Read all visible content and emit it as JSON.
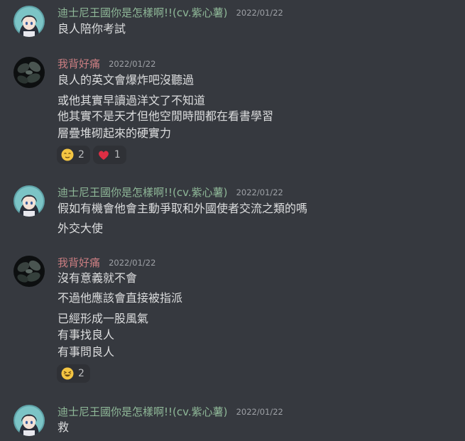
{
  "users": {
    "disney": {
      "name": "迪士尼王國你是怎樣啊!!(cv.紫心薯)",
      "color": "#8fb898"
    },
    "backpain": {
      "name": "我背好痛",
      "color": "#c97d81"
    }
  },
  "messages": [
    {
      "author": "迪士尼王國你是怎樣啊!!(cv.紫心薯)",
      "timestamp": "2022/01/22",
      "avatar": "anime-girl-avatar",
      "lines": [
        "良人陪你考試"
      ]
    },
    {
      "author": "我背好痛",
      "timestamp": "2022/01/22",
      "avatar": "dark-plant-avatar",
      "lines": [
        "良人的英文會爆炸吧沒聽過",
        "或他其實早讀過洋文了不知道",
        "他其實不是天才但他空閒時間都在看書學習",
        "層疊堆砌起來的硬實力"
      ],
      "reactions": [
        {
          "emoji": "relieved-face-emoji",
          "count": "2"
        },
        {
          "emoji": "heart-emoji",
          "count": "1"
        }
      ]
    },
    {
      "author": "迪士尼王國你是怎樣啊!!(cv.紫心薯)",
      "timestamp": "2022/01/22",
      "avatar": "anime-girl-avatar",
      "lines": [
        "假如有機會他會主動爭取和外國使者交流之類的嗎",
        "外交大使"
      ]
    },
    {
      "author": "我背好痛",
      "timestamp": "2022/01/22",
      "avatar": "dark-plant-avatar",
      "lines": [
        "沒有意義就不會",
        "不過他應該會直接被指派",
        "已經形成一股風氣",
        "有事找良人",
        "有事問良人"
      ],
      "reactions": [
        {
          "emoji": "laughing-face-emoji",
          "count": "2"
        }
      ]
    },
    {
      "author": "迪士尼王國你是怎樣啊!!(cv.紫心薯)",
      "timestamp": "2022/01/22",
      "avatar": "anime-girl-avatar",
      "lines": [
        "救"
      ]
    }
  ]
}
